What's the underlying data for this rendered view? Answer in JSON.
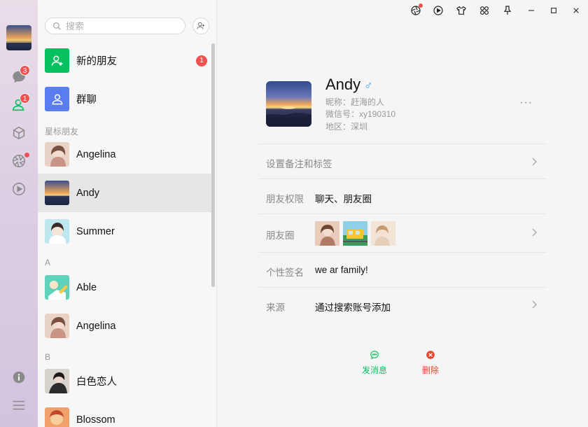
{
  "colors": {
    "accent_green": "#07c160",
    "badge_red": "#f05252",
    "male_blue": "#3da8f5",
    "delete_red": "#e8452c"
  },
  "rail": {
    "avatar": "sunset-avatar",
    "chat_badge": "3",
    "contacts_badge": "1",
    "icons": [
      "chat-icon",
      "contacts-icon",
      "cube-icon",
      "aperture-icon",
      "play-icon",
      "info-icon",
      "menu-icon"
    ]
  },
  "search": {
    "placeholder": "搜索"
  },
  "list": {
    "new_friends": {
      "label": "新的朋友",
      "count": "1"
    },
    "group_chat": {
      "label": "群聊"
    },
    "sections": {
      "starred": "星标朋友",
      "a": "A",
      "b": "B"
    },
    "items": [
      {
        "name": "Angelina"
      },
      {
        "name": "Andy"
      },
      {
        "name": "Summer"
      },
      {
        "name": "Able"
      },
      {
        "name": "Angelina"
      },
      {
        "name": "白色恋人"
      },
      {
        "name": "Blossom"
      }
    ]
  },
  "titlebar": {
    "icons": [
      "aperture-icon",
      "play-icon",
      "shirt-icon",
      "apps-icon",
      "pin-icon",
      "minimize-icon",
      "maximize-icon",
      "close-icon"
    ]
  },
  "profile": {
    "name": "Andy",
    "gender_symbol": "♂",
    "nickname": "昵称：赶海的人",
    "wechat_id": "微信号：xy190310",
    "region": "地区：深圳",
    "more": "···"
  },
  "details": {
    "remark_label": "设置备注和标签",
    "permission_label": "朋友权限",
    "permission_value": "聊天、朋友圈",
    "moments_label": "朋友圈",
    "signature_label": "个性签名",
    "signature_value": "we ar family!",
    "source_label": "来源",
    "source_value": "通过搜索账号添加"
  },
  "actions": {
    "message": "发消息",
    "delete": "删除"
  }
}
